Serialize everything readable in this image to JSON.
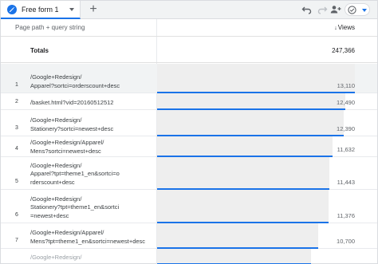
{
  "tab": {
    "label": "Free form 1",
    "add_label": "+"
  },
  "toolbar": {
    "undo": "undo-icon",
    "redo": "redo-icon",
    "share": "share-people-icon",
    "status": "check-circle-icon"
  },
  "table": {
    "dimension_header": "Page path + query string",
    "metric_header": "Views",
    "sort_indicator": "↓",
    "totals_label": "Totals",
    "totals_value": "247,366",
    "max_value": 13110,
    "rows": [
      {
        "num": "1",
        "page": "/Google+Redesign/\nApparel?sortci=orderscount+desc",
        "views": "13,110",
        "value": 13110
      },
      {
        "num": "2",
        "page": "/basket.html?vid=20160512512",
        "views": "12,490",
        "value": 12490
      },
      {
        "num": "3",
        "page": "/Google+Redesign/\nStationery?sortci=newest+desc",
        "views": "12,390",
        "value": 12390
      },
      {
        "num": "4",
        "page": "/Google+Redesign/Apparel/\nMens?sortci=newest+desc",
        "views": "11,632",
        "value": 11632
      },
      {
        "num": "5",
        "page": "/Google+Redesign/\nApparel?tpt=theme1_en&sortci=o\nrderscount+desc",
        "views": "11,443",
        "value": 11443
      },
      {
        "num": "6",
        "page": "/Google+Redesign/\nStationery?tpt=theme1_en&sortci\n=newest+desc",
        "views": "11,376",
        "value": 11376
      },
      {
        "num": "7",
        "page": "/Google+Redesign/Apparel/\nMens?tpt=theme1_en&sortci=newest+desc",
        "views": "10,700",
        "value": 10700
      },
      {
        "num": "",
        "page": "/Google+Redesign/",
        "views": "",
        "value": 10200
      }
    ]
  },
  "colors": {
    "accent": "#1a73e8",
    "bar": "#eeeeee"
  }
}
